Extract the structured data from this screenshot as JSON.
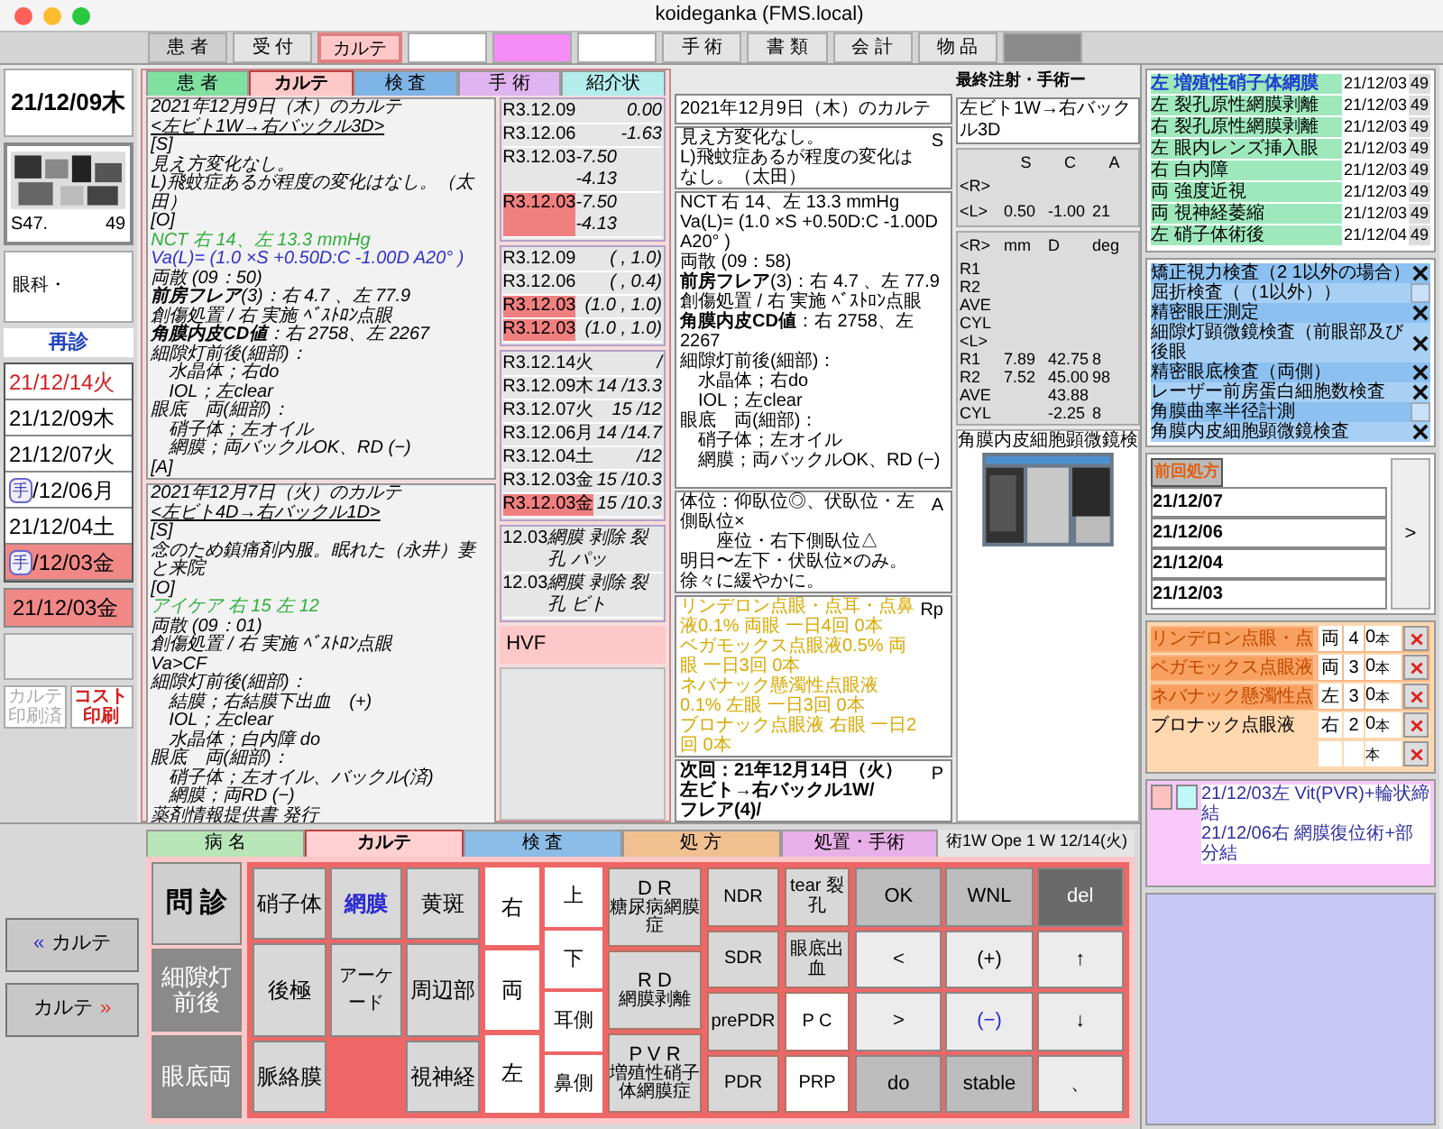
{
  "window": {
    "title": "koideganka (FMS.local)"
  },
  "top_tabs": [
    {
      "label": "患 者",
      "kind": "grey",
      "selected": false
    },
    {
      "label": "受 付",
      "kind": "light",
      "selected": false
    },
    {
      "label": "カルテ",
      "kind": "pink",
      "selected": true
    },
    {
      "kind": "white",
      "selected": false
    },
    {
      "kind": "magenta",
      "selected": false
    },
    {
      "kind": "white",
      "selected": false
    },
    {
      "label": "手 術",
      "kind": "light",
      "selected": false
    },
    {
      "label": "書 類",
      "kind": "light",
      "selected": false
    },
    {
      "label": "会 計",
      "kind": "light",
      "selected": false
    },
    {
      "label": "物 品",
      "kind": "light",
      "selected": false
    },
    {
      "kind": "dark",
      "selected": false
    }
  ],
  "left_panel": {
    "date": "21/12/09木",
    "patient": {
      "era": "S47.",
      "age": "49",
      "dept": "眼科・"
    },
    "visit_type": "再診",
    "dates": [
      {
        "text": "21/12/14火",
        "red": true,
        "selected": false
      },
      {
        "text": "21/12/09木",
        "red": false,
        "selected": false
      },
      {
        "text": "21/12/07火",
        "red": false,
        "selected": false
      },
      {
        "badge": "手",
        "text": "/12/06月",
        "red": false,
        "selected": false
      },
      {
        "text": "21/12/04土",
        "red": false,
        "selected": false
      },
      {
        "badge": "手",
        "text": "/12/03金",
        "red": false,
        "selected": true
      }
    ],
    "current_date": "21/12/03金",
    "buttons": [
      {
        "label": "カルテ印刷済",
        "disabled": true
      },
      {
        "label": "コスト印刷",
        "disabled": false
      }
    ]
  },
  "chart_tabs": [
    {
      "label": "患 者",
      "color": "#7fe0a0",
      "selected": false
    },
    {
      "label": "カルテ",
      "color": "#ffc8c8",
      "selected": true
    },
    {
      "label": "検 査",
      "color": "#7fb4e6",
      "selected": false
    },
    {
      "label": "手 術",
      "color": "#e0b4f0",
      "selected": false
    },
    {
      "label": "紹介状",
      "color": "#b4ecec",
      "selected": false
    }
  ],
  "notes": [
    {
      "lines": [
        {
          "text": "2021年12月9日（木）のカルテ",
          "kind": "plain"
        },
        {
          "text": "<左ビト1W→右バックル3D>",
          "kind": "underline"
        },
        {
          "text": "[S]",
          "kind": "plain"
        },
        {
          "text": "見え方変化なし。",
          "kind": "plain"
        },
        {
          "text": "L)飛蚊症あるが程度の変化はなし。（太田）",
          "kind": "plain"
        },
        {
          "text": "[O]",
          "kind": "plain"
        },
        {
          "text": "NCT 右 14、左 13.3 mmHg",
          "kind": "green"
        },
        {
          "text": "Va(L)= (1.0 ×S +0.50D:C -1.00D A20° )",
          "kind": "blue"
        },
        {
          "text": "両散 (09：50)",
          "kind": "plain"
        },
        {
          "text": "**前房フレア**(3)：右 4.7 、左 77.9",
          "kind": "plain"
        },
        {
          "text": "創傷処置 / 右 実施 ﾍﾞｽﾄﾛﾝ点眼",
          "kind": "plain"
        },
        {
          "text": "**角膜内皮CD値**：右 2758、左 2267",
          "kind": "plain"
        },
        {
          "text": "細隙灯前後(細部)：",
          "kind": "plain"
        },
        {
          "text": "　水晶体；右do",
          "kind": "plain"
        },
        {
          "text": "　IOL；左clear",
          "kind": "plain"
        },
        {
          "text": "眼底　両(細部)：",
          "kind": "plain"
        },
        {
          "text": "　硝子体；左オイル",
          "kind": "plain"
        },
        {
          "text": "　網膜；両バックルOK、RD (−)",
          "kind": "plain"
        },
        {
          "text": "[A]",
          "kind": "plain"
        }
      ]
    },
    {
      "lines": [
        {
          "text": "2021年12月7日（火）のカルテ",
          "kind": "plain"
        },
        {
          "text": "<左ビト4D→右バックル1D>",
          "kind": "underline"
        },
        {
          "text": "[S]",
          "kind": "plain"
        },
        {
          "text": "念のため鎮痛剤内服。眠れた（永井）妻と来院",
          "kind": "plain"
        },
        {
          "text": "[O]",
          "kind": "plain"
        },
        {
          "text": "アイケア 右 15 左 12",
          "kind": "green"
        },
        {
          "text": "両散 (09：01)",
          "kind": "plain"
        },
        {
          "text": "創傷処置 / 右 実施 ﾍﾞｽﾄﾛﾝ点眼",
          "kind": "plain"
        },
        {
          "text": "Va>CF",
          "kind": "plain"
        },
        {
          "text": "細隙灯前後(細部)：",
          "kind": "plain"
        },
        {
          "text": "　結膜；右結膜下出血　(+)",
          "kind": "plain"
        },
        {
          "text": "　IOL；左clear",
          "kind": "plain"
        },
        {
          "text": "　水晶体；白内障 do",
          "kind": "plain"
        },
        {
          "text": "眼底　両(細部)：",
          "kind": "plain"
        },
        {
          "text": "　硝子体；左オイル、バックル(済)",
          "kind": "plain"
        },
        {
          "text": "　網膜；両RD (−)",
          "kind": "plain"
        },
        {
          "text": "薬剤情報提供書 発行",
          "kind": "plain"
        }
      ]
    }
  ],
  "value_groups": [
    {
      "rows": [
        {
          "date": "R3.12.09",
          "value": "0.00",
          "highlight": false
        },
        {
          "date": "R3.12.06",
          "value": "-1.63",
          "highlight": false
        },
        {
          "date": "R3.12.03",
          "value": "-7.50 -4.13",
          "highlight": false
        },
        {
          "date": "R3.12.03",
          "value": "-7.50 -4.13",
          "highlight": true
        }
      ]
    },
    {
      "rows": [
        {
          "date": "R3.12.09",
          "value": "(   , 1.0)",
          "highlight": false
        },
        {
          "date": "R3.12.06",
          "value": "(   , 0.4)",
          "highlight": false
        },
        {
          "date": "R3.12.03",
          "value": "(1.0 , 1.0)",
          "highlight": true
        },
        {
          "date": "R3.12.03",
          "value": "(1.0 , 1.0)",
          "highlight": true
        }
      ]
    },
    {
      "rows": [
        {
          "date": "R3.12.14火",
          "value": "/",
          "highlight": false
        },
        {
          "date": "R3.12.09木",
          "value": "14 /13.3",
          "highlight": false
        },
        {
          "date": "R3.12.07火",
          "value": "15 /12",
          "highlight": false
        },
        {
          "date": "R3.12.06月",
          "value": "14 /14.7",
          "highlight": false
        },
        {
          "date": "R3.12.04土",
          "value": "/12",
          "highlight": false
        },
        {
          "date": "R3.12.03金",
          "value": "15 /10.3",
          "highlight": false
        },
        {
          "date": "R3.12.03金",
          "value": "15 /10.3",
          "highlight": true
        }
      ]
    },
    {
      "rows": [
        {
          "date": "12.03",
          "value": "網膜 剥除 裂孔 パッ",
          "highlight": false
        },
        {
          "date": "12.03",
          "value": "網膜 剥除 裂孔 ビト",
          "highlight": false
        }
      ]
    }
  ],
  "hvf_label": "HVF",
  "chart_detail": {
    "title": "2021年12月9日（木）のカルテ",
    "sections": [
      {
        "tag": "S",
        "kind": "plain",
        "lines": [
          "見え方変化なし。",
          "L)飛蚊症あるが程度の変化はなし。（太田）"
        ]
      },
      {
        "kind": "exam",
        "lines": [
          "NCT 右 14、左 13.3 mmHg",
          "Va(L)= (1.0 ×S +0.50D:C -1.00D A20° )",
          "両散 (09：58)",
          "**前房フレア**(3)：右 4.7 、左 77.9",
          "創傷処置 / 右 実施 ﾍﾞｽﾄﾛﾝ点眼",
          "**角膜内皮CD値**：右 2758、左 2267",
          "細隙灯前後(細部)：",
          "　水晶体；右do",
          "　IOL；左clear",
          "眼底　両(細部)：",
          "　硝子体；左オイル",
          "　網膜；両バックルOK、RD (−)"
        ]
      },
      {
        "tag": "A",
        "kind": "plain",
        "lines": [
          "体位：仰臥位◎、伏臥位・左側臥位×",
          "　　座位・右下側臥位△",
          "明日〜左下・伏臥位×のみ。徐々に緩やかに。"
        ]
      },
      {
        "tag": "Rp",
        "kind": "rx",
        "lines": [
          "リンデロン点眼・点耳・点鼻液0.1% 両眼 一日4回 0本",
          "ベガモックス点眼液0.5% 両眼 一日3回 0本",
          "ネバナック懸濁性点眼液0.1% 左眼 一日3回 0本",
          "ブロナック点眼液 右眼 一日2回 0本"
        ]
      },
      {
        "tag": "P",
        "kind": "bold",
        "lines": [
          "次回：21年12月14日（火）",
          "左ビト→右バックル1W/",
          "フレア(4)/"
        ]
      }
    ]
  },
  "last_procedure": {
    "label": "最終注射・手術ー",
    "value": "左ビト1W→右バックル3D"
  },
  "refraction": {
    "header": [
      "S",
      "C",
      "A"
    ],
    "rows": [
      [
        "<R>",
        "",
        "",
        ""
      ],
      [
        "<L>",
        "0.50",
        "-1.00",
        "21"
      ]
    ]
  },
  "keratometry": {
    "header": [
      "<R>",
      "mm",
      "D",
      "deg"
    ],
    "rows": [
      [
        "R1",
        "",
        "",
        ""
      ],
      [
        "R2",
        "",
        "",
        ""
      ],
      [
        "AVE",
        "",
        "",
        ""
      ],
      [
        "CYL",
        "",
        "",
        ""
      ],
      [
        "<L>",
        "",
        "",
        ""
      ],
      [
        "R1",
        "7.89",
        "42.75",
        "8"
      ],
      [
        "R2",
        "7.52",
        "45.00",
        "98"
      ],
      [
        "AVE",
        "",
        "43.88",
        ""
      ],
      [
        "CYL",
        "",
        "-2.25",
        "8"
      ]
    ]
  },
  "endothelium": {
    "title": "角膜内皮細胞顕微鏡検"
  },
  "diseases": [
    {
      "side": "左",
      "name": "増殖性硝子体網膜",
      "date": "21/12/03",
      "age": "49",
      "selected": true
    },
    {
      "side": "左",
      "name": "裂孔原性網膜剥離",
      "date": "21/12/03",
      "age": "49",
      "selected": false
    },
    {
      "side": "右",
      "name": "裂孔原性網膜剥離",
      "date": "21/12/03",
      "age": "49",
      "selected": false
    },
    {
      "side": "左",
      "name": "眼内レンズ挿入眼",
      "date": "21/12/03",
      "age": "49",
      "selected": false
    },
    {
      "side": "右",
      "name": "白内障",
      "date": "21/12/03",
      "age": "49",
      "selected": false
    },
    {
      "side": "両",
      "name": "強度近視",
      "date": "21/12/03",
      "age": "49",
      "selected": false
    },
    {
      "side": "両",
      "name": "視神経萎縮",
      "date": "21/12/03",
      "age": "49",
      "selected": false
    },
    {
      "side": "左",
      "name": "硝子体術後",
      "date": "21/12/04",
      "age": "49",
      "selected": false
    }
  ],
  "exams": [
    {
      "name": "矯正視力検査（2 1以外の場合）",
      "checked": true
    },
    {
      "name": "屈折検査（（1以外））",
      "checked": false
    },
    {
      "name": "精密眼圧測定",
      "checked": true
    },
    {
      "name": "細隙灯顕微鏡検査（前眼部及び後眼",
      "checked": true
    },
    {
      "name": "精密眼底検査（両側）",
      "checked": true
    },
    {
      "name": "レーザー前房蛋白細胞数検査",
      "checked": true
    },
    {
      "name": "角膜曲率半径計測",
      "checked": false
    },
    {
      "name": "角膜内皮細胞顕微鏡検査",
      "checked": true
    }
  ],
  "prescription": {
    "previous_button": "前回処方",
    "dates": [
      "21/12/07",
      "21/12/06",
      "21/12/04",
      "21/12/03"
    ],
    "next_button": ">",
    "drops": [
      {
        "name": "リンデロン点眼・点",
        "eye": "両",
        "times": "4",
        "qty": "0",
        "unit": "本",
        "highlighted": true
      },
      {
        "name": "ベガモックス点眼液",
        "eye": "両",
        "times": "3",
        "qty": "0",
        "unit": "本",
        "highlighted": true
      },
      {
        "name": "ネバナック懸濁性点",
        "eye": "左",
        "times": "3",
        "qty": "0",
        "unit": "本",
        "highlighted": true
      },
      {
        "name": "ブロナック点眼液",
        "eye": "右",
        "times": "2",
        "qty": "0",
        "unit": "本",
        "highlighted": false
      },
      {
        "unit": "本",
        "highlighted": false
      }
    ]
  },
  "surgeries": [
    {
      "text": "21/12/03左 Vit(PVR)+輪状締結"
    },
    {
      "text": "21/12/06右 網膜復位術+部分結"
    }
  ],
  "nav_buttons": [
    {
      "label": "カルテ",
      "icon": "«",
      "kind": "back"
    },
    {
      "label": "カルテ",
      "icon": "»",
      "kind": "forward"
    }
  ],
  "input_tabs": [
    {
      "label": "病 名",
      "color": "#b8e6b8",
      "selected": false
    },
    {
      "label": "カルテ",
      "color": "#ffd0d0",
      "selected": true
    },
    {
      "label": "検 査",
      "color": "#8cbce8",
      "selected": false
    },
    {
      "label": "処 方",
      "color": "#f0c090",
      "selected": false
    },
    {
      "label": "処置・手術",
      "color": "#e8b0e8",
      "selected": false
    }
  ],
  "input_info": "術1W Ope 1 W 12/14(火)",
  "input_pad": {
    "sections": [
      {
        "label": "問 診",
        "disabled": false
      },
      {
        "label": "細隙灯前後",
        "disabled": true
      },
      {
        "label": "眼底両",
        "disabled": true
      }
    ],
    "anatomy": [
      {
        "label": "硝子体",
        "selected": false
      },
      {
        "label": "網膜",
        "selected": true
      },
      {
        "label": "黄斑",
        "selected": false
      },
      {
        "label": "後極",
        "selected": false
      },
      {
        "label": "アーケード",
        "selected": false
      },
      {
        "label": "周辺部",
        "selected": false
      },
      {
        "label": "脈絡膜",
        "selected": false
      },
      {
        "kind": "empty"
      },
      {
        "label": "視神経",
        "selected": false
      }
    ],
    "sides": [
      "右",
      "両",
      "左"
    ],
    "directions": [
      "上",
      "下",
      "耳側",
      "鼻側"
    ],
    "diagnoses": [
      {
        "code": "D R",
        "label": "糖尿病網膜症"
      },
      {
        "code": "R D",
        "label": "網膜剥離"
      },
      {
        "code": "P V R",
        "label": "増殖性硝子体網膜症"
      }
    ],
    "grades": [
      "NDR",
      "SDR",
      "prePDR",
      "PDR"
    ],
    "findings": [
      {
        "label": "tear 裂孔",
        "white": false
      },
      {
        "label": "眼底出血",
        "white": false
      },
      {
        "label": "P C",
        "white": true
      },
      {
        "label": "PRP",
        "white": true
      }
    ],
    "keys": [
      {
        "label": "OK",
        "kind": "grey"
      },
      {
        "label": "WNL",
        "kind": "grey"
      },
      {
        "label": "del",
        "kind": "dark"
      },
      {
        "label": "<",
        "kind": "light"
      },
      {
        "label": "(+)",
        "kind": "light"
      },
      {
        "label": "↑",
        "kind": "light"
      },
      {
        "label": ">",
        "kind": "light"
      },
      {
        "label": "(−)",
        "kind": "blue"
      },
      {
        "label": "↓",
        "kind": "light"
      },
      {
        "label": "do",
        "kind": "grey"
      },
      {
        "label": "stable",
        "kind": "grey"
      },
      {
        "label": "、",
        "kind": "light"
      }
    ]
  }
}
